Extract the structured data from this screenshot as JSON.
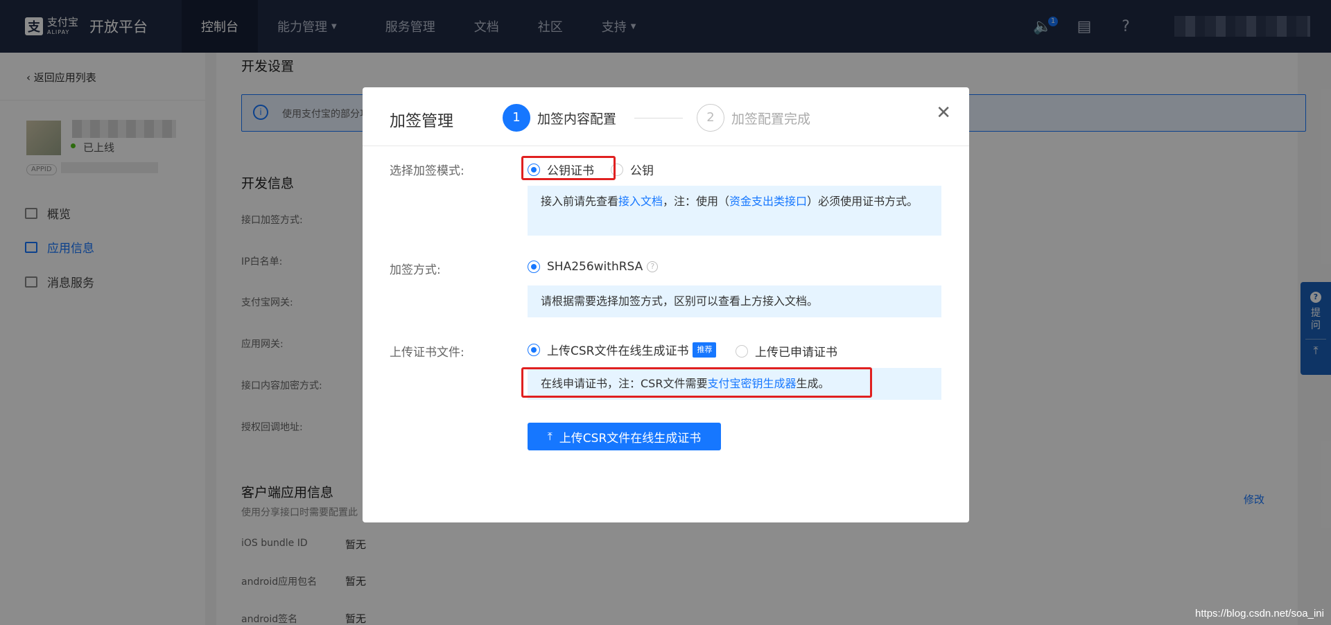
{
  "topnav": {
    "logo_cn": "支付宝",
    "logo_en": "ALIPAY",
    "title": "开放平台",
    "items": [
      "控制台",
      "能力管理",
      "服务管理",
      "文档",
      "社区",
      "支持"
    ],
    "badge_count": "1"
  },
  "sidebar": {
    "back": "返回应用列表",
    "status": "已上线",
    "appid_tag": "APPID",
    "menu": [
      "概览",
      "应用信息",
      "消息服务"
    ]
  },
  "main": {
    "dev_settings_title": "开发设置",
    "banner_text": "使用支付宝的部分功",
    "dev_info_title": "开发信息",
    "fields": [
      "接口加签方式:",
      "IP白名单:",
      "支付宝网关:",
      "应用网关:",
      "接口内容加密方式:",
      "授权回调地址:"
    ],
    "client_title": "客户端应用信息",
    "client_note": "使用分享接口时需要配置此",
    "edit": "修改",
    "client_fields": [
      {
        "label": "iOS bundle ID",
        "value": "暂无"
      },
      {
        "label": "android应用包名",
        "value": "暂无"
      },
      {
        "label": "android签名",
        "value": "暂无"
      }
    ]
  },
  "float_help": {
    "label_1": "提",
    "label_2": "问"
  },
  "modal": {
    "title": "加签管理",
    "step1": {
      "num": "1",
      "label": "加签内容配置"
    },
    "step2": {
      "num": "2",
      "label": "加签配置完成"
    },
    "mode_label": "选择加签模式:",
    "mode_opt1": "公钥证书",
    "mode_opt2": "公钥",
    "mode_note_pre": "接入前请先查看",
    "mode_note_link1": "接入文档",
    "mode_note_mid": "，注：使用（",
    "mode_note_link2": "资金支出类接口",
    "mode_note_post": "）必须使用证书方式。",
    "sign_label": "加签方式:",
    "sign_opt": "SHA256withRSA",
    "sign_note": "请根据需要选择加签方式，区别可以查看上方接入文档。",
    "upload_label": "上传证书文件:",
    "upload_opt1": "上传CSR文件在线生成证书",
    "rec_tag": "推荐",
    "upload_opt2": "上传已申请证书",
    "upload_note_pre": "在线申请证书，注：CSR文件需要",
    "upload_note_link": "支付宝密钥生成器",
    "upload_note_post": "生成。",
    "upload_button": "上传CSR文件在线生成证书"
  },
  "watermark": "https://blog.csdn.net/soa_ini"
}
